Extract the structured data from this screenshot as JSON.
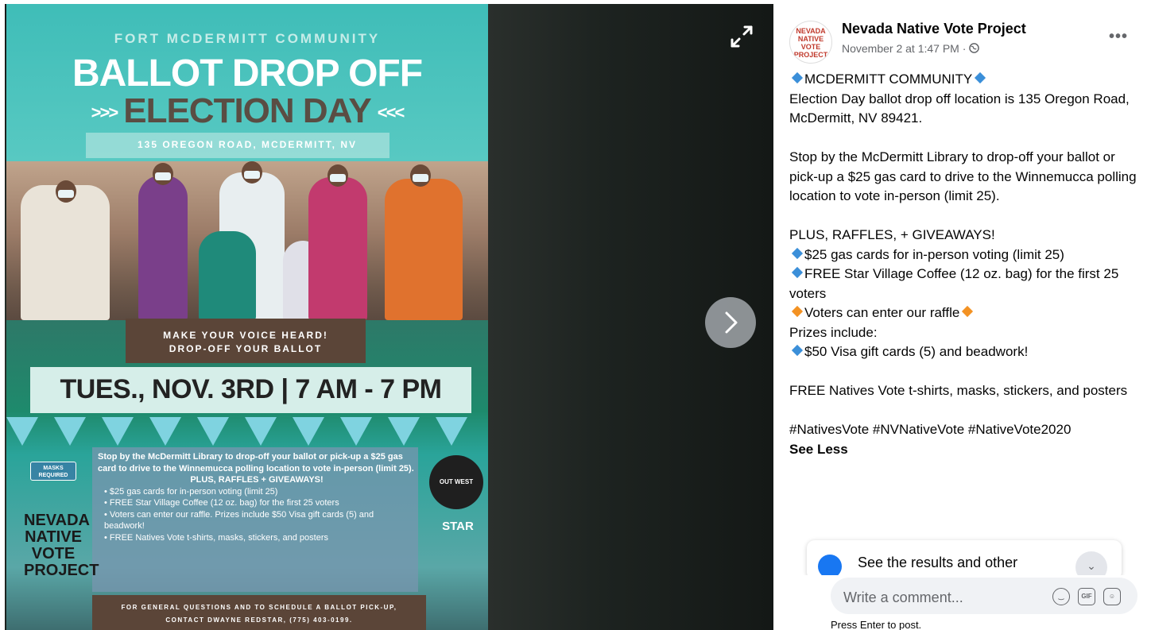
{
  "poster": {
    "subtitle": "FORT MCDERMITT COMMUNITY",
    "title": "BALLOT DROP OFF",
    "title2": "ELECTION DAY",
    "chev_left": ">>>",
    "chev_right": "<<<",
    "address": "135 OREGON ROAD, MCDERMITT, NV",
    "voice_line1": "MAKE YOUR VOICE HEARD!",
    "voice_line2": "DROP-OFF YOUR BALLOT",
    "date": "TUES., NOV. 3RD | 7 AM - 7 PM",
    "masks_badge": "MASKS REQUIRED",
    "info_intro": "Stop by the McDermitt Library to drop-off your ballot or pick-up a $25 gas card to drive to the Winnemucca polling location to vote in-person (limit 25).",
    "info_plus": "PLUS, RAFFLES + GIVEAWAYS!",
    "info_items": [
      "$25 gas cards for in-person voting (limit 25)",
      "FREE Star Village Coffee (12 oz. bag) for the first 25 voters",
      "Voters can enter our raffle. Prizes include $50 Visa gift cards (5) and beadwork!",
      "FREE Natives Vote t-shirts, masks, stickers, and posters"
    ],
    "logo_nnvp": "NEVADA NATIVE VOTE PROJECT",
    "logo_outwest": "OUT WEST",
    "logo_star": "STAR",
    "footer_line1": "FOR GENERAL QUESTIONS AND TO SCHEDULE A BALLOT PICK-UP,",
    "footer_line2": "CONTACT DWAYNE REDSTAR, (775) 403-0199."
  },
  "post": {
    "page_name": "Nevada Native Vote Project",
    "meta": "November 2 at 1:47 PM ·",
    "avatar_text": "NEVADA NATIVE VOTE PROJECT",
    "more_label": "•••",
    "line_title": "MCDERMITT COMMUNITY",
    "para1": "Election Day ballot drop off location is 135 Oregon Road, McDermitt, NV 89421.",
    "para2": "Stop by the McDermitt Library to drop-off your ballot or pick-up a $25 gas card to drive to the Winnemucca polling location to vote in-person (limit 25).",
    "plus": "PLUS, RAFFLES, + GIVEAWAYS!",
    "item1": "$25 gas cards for in-person voting (limit 25)",
    "item2": "FREE Star Village Coffee (12 oz. bag) for the first 25 voters",
    "raffle": "Voters can enter our raffle",
    "prizes": "Prizes include:",
    "item3": "$50 Visa gift cards (5) and beadwork!",
    "para3": "FREE Natives Vote t-shirts, masks, stickers, and posters",
    "hashtags": "#NativesVote #NVNativeVote #NativeVote2020",
    "see_less": "See Less"
  },
  "results_card": {
    "text": "See the results and other"
  },
  "comment": {
    "placeholder": "Write a comment...",
    "press_enter": "Press Enter to post.",
    "gif_label": "GIF"
  },
  "icons": {
    "expand": "expand-icon",
    "next": "chevron-right-icon",
    "globe": "globe-icon",
    "emoji": "emoji-icon",
    "gif": "gif-icon",
    "sticker": "sticker-icon"
  },
  "colors": {
    "diamond_blue": "#3b8fd9",
    "diamond_orange": "#f39223",
    "fb_blue": "#1877f2"
  }
}
